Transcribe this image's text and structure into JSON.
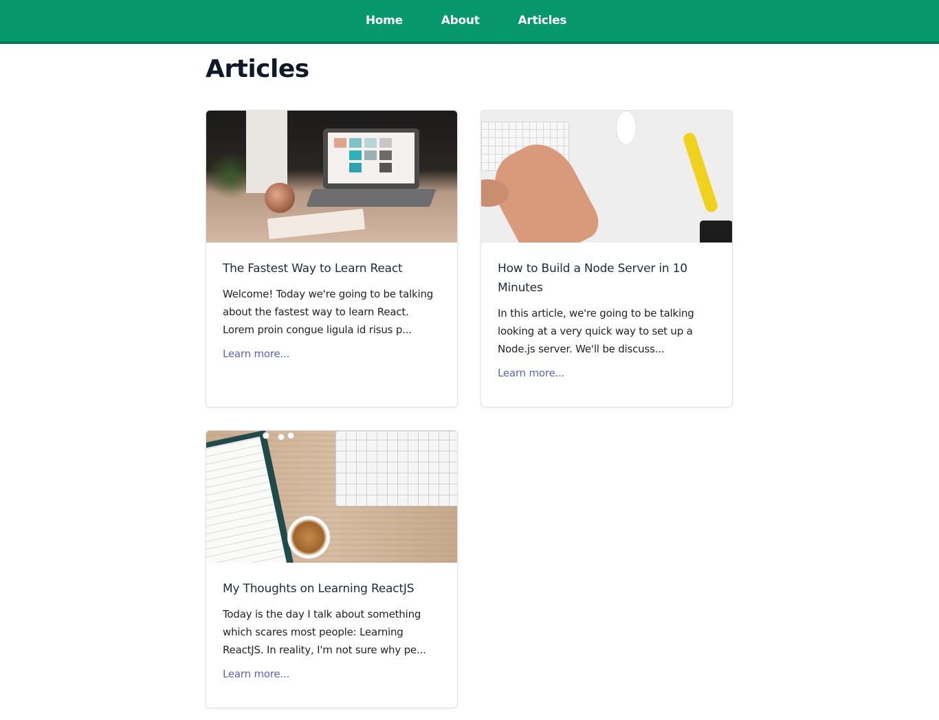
{
  "nav": {
    "links": [
      "Home",
      "About",
      "Articles"
    ]
  },
  "page": {
    "title": "Articles"
  },
  "articles": [
    {
      "title": "The Fastest Way to Learn React",
      "excerpt": "Welcome! Today we're going to be talking about the fastest way to learn React. Lorem proin congue ligula id risus p...",
      "link_label": "Learn more...",
      "image": "laptop-desk-photo"
    },
    {
      "title": "How to Build a Node Server in 10 Minutes",
      "excerpt": "In this article, we're going to be talking looking at a very quick way to set up a Node.js server. We'll be discuss...",
      "link_label": "Learn more...",
      "image": "keyboard-hands-photo"
    },
    {
      "title": "My Thoughts on Learning ReactJS",
      "excerpt": "Today is the day I talk about something which scares most people: Learning ReactJS. In reality, I'm not sure why pe...",
      "link_label": "Learn more...",
      "image": "notebook-coffee-photo"
    }
  ],
  "colors": {
    "nav_bg": "#06976b",
    "link": "#5a62c9"
  }
}
